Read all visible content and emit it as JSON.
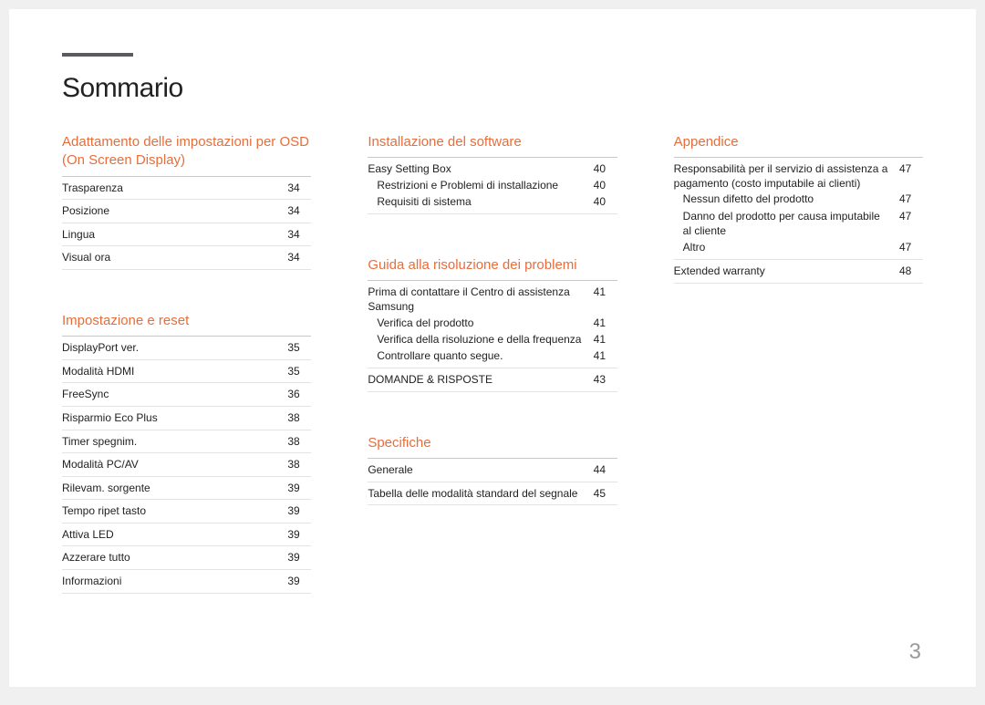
{
  "pageTitle": "Sommario",
  "pageNumber": "3",
  "columns": [
    {
      "sections": [
        {
          "title": "Adattamento delle impostazioni per OSD (On Screen Display)",
          "entries": [
            {
              "label": "Trasparenza",
              "page": "34"
            },
            {
              "label": "Posizione",
              "page": "34"
            },
            {
              "label": "Lingua",
              "page": "34"
            },
            {
              "label": "Visual ora",
              "page": "34"
            }
          ]
        },
        {
          "title": "Impostazione e reset",
          "entries": [
            {
              "label": "DisplayPort ver.",
              "page": "35"
            },
            {
              "label": "Modalità HDMI",
              "page": "35"
            },
            {
              "label": "FreeSync",
              "page": "36"
            },
            {
              "label": "Risparmio Eco Plus",
              "page": "38"
            },
            {
              "label": "Timer spegnim.",
              "page": "38"
            },
            {
              "label": "Modalità PC/AV",
              "page": "38"
            },
            {
              "label": "Rilevam. sorgente",
              "page": "39"
            },
            {
              "label": "Tempo ripet tasto",
              "page": "39"
            },
            {
              "label": "Attiva LED",
              "page": "39"
            },
            {
              "label": "Azzerare tutto",
              "page": "39"
            },
            {
              "label": "Informazioni",
              "page": "39"
            }
          ]
        }
      ]
    },
    {
      "sections": [
        {
          "title": "Installazione del software",
          "entries": [
            {
              "label": "Easy Setting Box",
              "page": "40",
              "sub": [
                {
                  "label": "Restrizioni e Problemi di installazione",
                  "page": "40"
                },
                {
                  "label": "Requisiti di sistema",
                  "page": "40"
                }
              ]
            }
          ]
        },
        {
          "title": "Guida alla risoluzione dei problemi",
          "entries": [
            {
              "label": "Prima di contattare il Centro di assistenza Samsung",
              "page": "41",
              "sub": [
                {
                  "label": "Verifica del prodotto",
                  "page": "41"
                },
                {
                  "label": "Verifica della risoluzione e della frequenza",
                  "page": "41"
                },
                {
                  "label": "Controllare quanto segue.",
                  "page": "41"
                }
              ]
            },
            {
              "label": "DOMANDE & RISPOSTE",
              "page": "43"
            }
          ]
        },
        {
          "title": "Specifiche",
          "entries": [
            {
              "label": "Generale",
              "page": "44"
            },
            {
              "label": "Tabella delle modalità standard del segnale",
              "page": "45"
            }
          ]
        }
      ]
    },
    {
      "sections": [
        {
          "title": "Appendice",
          "entries": [
            {
              "label": "Responsabilità per il servizio di assistenza a pagamento (costo imputabile ai clienti)",
              "page": "47",
              "sub": [
                {
                  "label": "Nessun difetto del prodotto",
                  "page": "47"
                },
                {
                  "label": "Danno del prodotto per causa imputabile al cliente",
                  "page": "47"
                },
                {
                  "label": "Altro",
                  "page": "47"
                }
              ]
            },
            {
              "label": "Extended warranty",
              "page": "48"
            }
          ]
        }
      ]
    }
  ]
}
